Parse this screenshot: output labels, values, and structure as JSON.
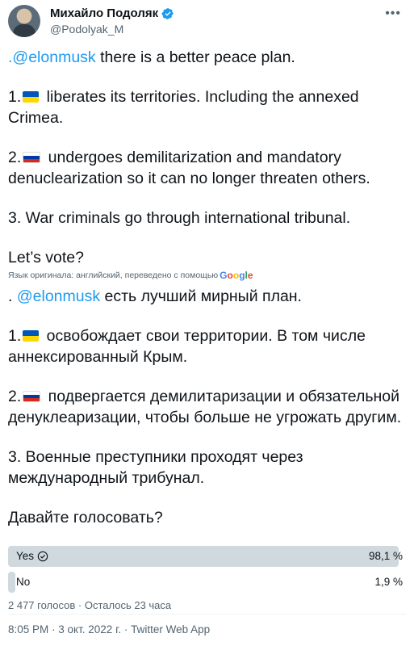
{
  "author": {
    "display_name": "Михайло Подоляк",
    "handle": "@Podolyak_M",
    "verified": true
  },
  "more_icon": "more-icon",
  "tweet_en": {
    "p1_mention": ".@elonmusk",
    "p1_text": " there is a better peace plan.",
    "p2_prefix": "1.",
    "p2_text": " liberates its territories. Including the annexed Crimea.",
    "p3_prefix": "2.",
    "p3_text": " undergoes demilitarization and mandatory denuclearization so it can no longer threaten others.",
    "p4_text": "3. War criminals go through international tribunal.",
    "p5_text": "Let’s vote?"
  },
  "translation_note": "Язык оригинала: английский, переведено с помощью",
  "translation_provider": "Google",
  "tweet_ru": {
    "p1_prefix": ". ",
    "p1_mention": "@elonmusk",
    "p1_text": " есть лучший мирный план.",
    "p2_prefix": "1.",
    "p2_text": " освобождает свои территории. В том числе аннексированный Крым.",
    "p3_prefix": "2.",
    "p3_text": " подвергается демилитаризации и обязательной денуклеаризации, чтобы больше не угрожать другим.",
    "p4_text": "3. Военные преступники проходят через международный трибунал.",
    "p5_text": "Давайте голосовать?"
  },
  "poll": {
    "options": [
      {
        "label": "Yes",
        "percent_text": "98,1 %",
        "fraction": 0.981,
        "selected": true
      },
      {
        "label": "No",
        "percent_text": "1,9 %",
        "fraction": 0.019,
        "selected": false
      }
    ],
    "meta": "2 477 голосов · Осталось 23 часа"
  },
  "timestamp": "8:05 PM · 3 окт. 2022 г. · Twitter Web App",
  "colors": {
    "link": "#1d9bf0",
    "poll_bar": "#cfd9de",
    "secondary_text": "#536471"
  }
}
